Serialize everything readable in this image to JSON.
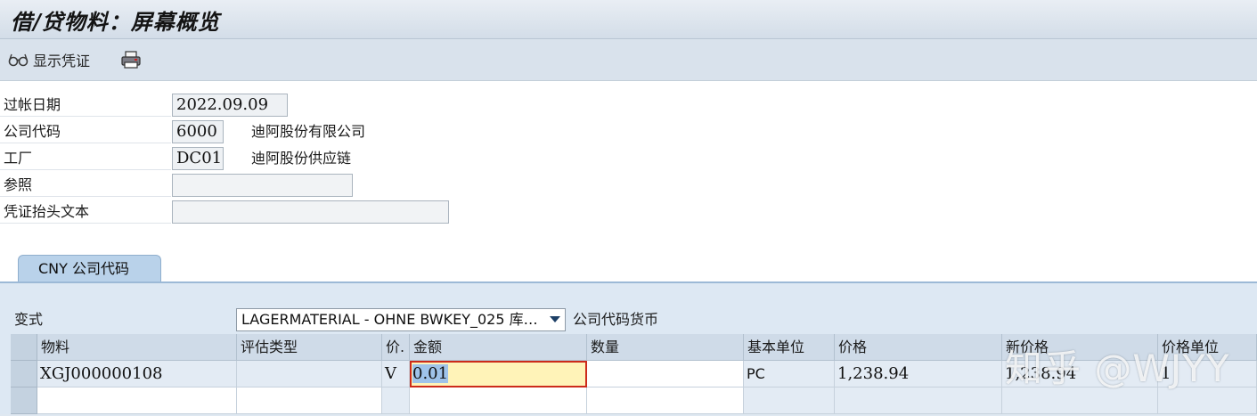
{
  "window": {
    "title": "借/贷物料：屏幕概览"
  },
  "toolbar": {
    "show_doc_label": "显示凭证",
    "show_doc_icon": "glasses-icon",
    "print_icon": "printer-icon"
  },
  "form": {
    "posting_date": {
      "label": "过帐日期",
      "value": "2022.09.09"
    },
    "company_code": {
      "label": "公司代码",
      "value": "6000",
      "desc": "迪阿股份有限公司"
    },
    "plant": {
      "label": "工厂",
      "value": "DC01",
      "desc": "迪阿股份供应链"
    },
    "reference": {
      "label": "参照",
      "value": ""
    },
    "header_text": {
      "label": "凭证抬头文本",
      "value": ""
    }
  },
  "tabs": [
    {
      "label": "CNY  公司代码",
      "active": true
    }
  ],
  "panel": {
    "variant_label": "变式",
    "variant_value": "LAGERMATERIAL - OHNE BWKEY_025 库…",
    "currency_label": "公司代码货币"
  },
  "grid": {
    "columns": [
      "物料",
      "评估类型",
      "价.",
      "金额",
      "数量",
      "基本单位",
      "价格",
      "新价格",
      "价格单位"
    ],
    "rows": [
      {
        "material": "XGJ000000108",
        "valuation_type": "",
        "price_ctrl": "V",
        "amount": "0.01",
        "quantity": "",
        "base_unit": "PC",
        "price": "1,238.94",
        "new_price": "1,238.94",
        "price_unit": "1"
      }
    ]
  },
  "watermark": "知乎 @WJYY",
  "colors": {
    "focus_field": "#fff3b8",
    "focus_border": "#cc2a1b",
    "tab_active": "#b9d2ea",
    "panel_bg": "#dde8f3"
  }
}
